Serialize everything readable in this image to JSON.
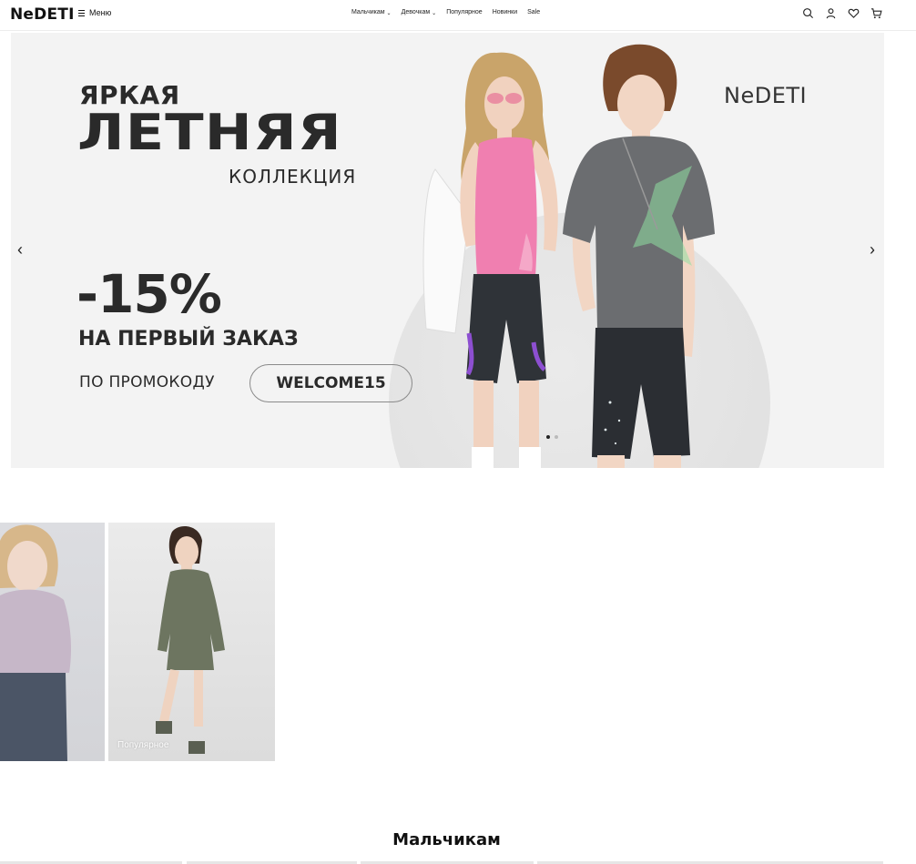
{
  "header": {
    "logo": "NeDETI",
    "menu_label": "Меню",
    "nav": [
      {
        "label": "Мальчикам",
        "has_dropdown": true
      },
      {
        "label": "Девочкам",
        "has_dropdown": true
      },
      {
        "label": "Популярное",
        "has_dropdown": false
      },
      {
        "label": "Новинки",
        "has_dropdown": false
      },
      {
        "label": "Sale",
        "has_dropdown": false
      }
    ],
    "icons": [
      "search-icon",
      "user-icon",
      "heart-icon",
      "cart-icon"
    ]
  },
  "hero": {
    "line1": "ЯРКАЯ",
    "line2": "ЛЕТНЯЯ",
    "line3": "КОЛЛЕКЦИЯ",
    "discount": "-15%",
    "offer": "НА ПЕРВЫЙ ЗАКАЗ",
    "promo_prefix": "ПО ПРОМОКОДУ",
    "promo_code": "WELCOME15",
    "brand": "NeDETI",
    "slides_total": 2,
    "slide_active": 1
  },
  "cards": [
    {
      "label": ""
    },
    {
      "label": "Популярное"
    }
  ],
  "section": {
    "title": "Мальчикам"
  },
  "colors": {
    "hero_bg": "#f3f3f3",
    "text_dark": "#2a2a2a",
    "pink_top": "#f07fb0",
    "grey_tee": "#6b6d70",
    "olive_dress": "#6d7560"
  }
}
